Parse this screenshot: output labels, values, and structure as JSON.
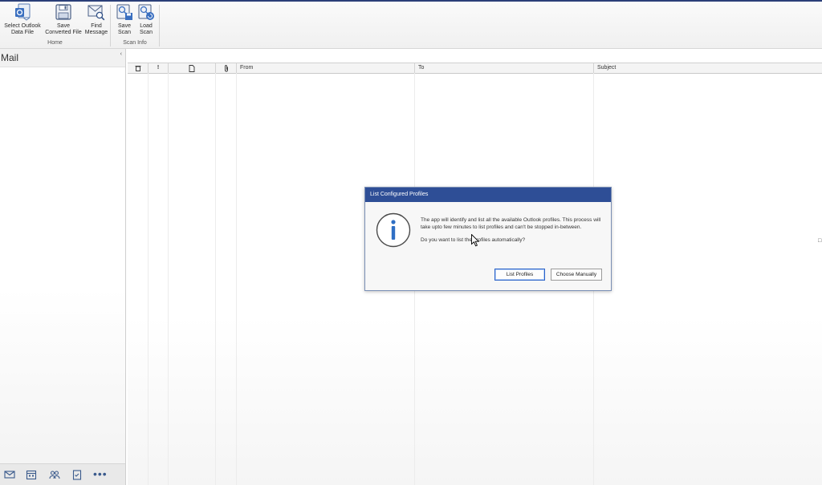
{
  "ribbon": {
    "groups": [
      {
        "label": "Home",
        "buttons": [
          {
            "label_line1": "Select Outlook",
            "label_line2": "Data File",
            "icon": "outlook-file-icon"
          },
          {
            "label_line1": "Save",
            "label_line2": "Converted File",
            "icon": "save-icon"
          },
          {
            "label_line1": "Find",
            "label_line2": "Message",
            "icon": "find-message-icon"
          }
        ]
      },
      {
        "label": "Scan Info",
        "buttons": [
          {
            "label_line1": "Save",
            "label_line2": "Scan",
            "icon": "save-scan-icon"
          },
          {
            "label_line1": "Load",
            "label_line2": "Scan",
            "icon": "load-scan-icon"
          }
        ]
      }
    ]
  },
  "leftpane": {
    "title": "Mail",
    "collapse_glyph": "‹",
    "nav_icons": [
      "mail-icon",
      "calendar-icon",
      "contacts-icon",
      "tasks-icon"
    ],
    "more_label": "•••"
  },
  "grid": {
    "columns": [
      {
        "icon": "delete-icon",
        "glyph": "🗑",
        "label": ""
      },
      {
        "icon": "importance-icon",
        "glyph": "!",
        "label": ""
      },
      {
        "icon": "document-icon",
        "glyph": "🗋",
        "label": ""
      },
      {
        "icon": "attachment-icon",
        "glyph": "📎",
        "label": ""
      },
      {
        "label": "From"
      },
      {
        "label": "To"
      },
      {
        "label": "Subject"
      }
    ]
  },
  "dialog": {
    "title": "List Configured Profiles",
    "message": "The app will identify and list all the available Outlook profiles. This process will take upto few minutes to list profiles and can't be stopped in-between.",
    "question": "Do you want to list the profiles automatically?",
    "primary_button": "List Profiles",
    "secondary_button": "Choose Manually",
    "icon": "info-icon"
  },
  "colors": {
    "dialog_title_bar": "#2e4e96",
    "info_icon_blue": "#2f6fc4",
    "top_stripe": "#2b3f78"
  }
}
